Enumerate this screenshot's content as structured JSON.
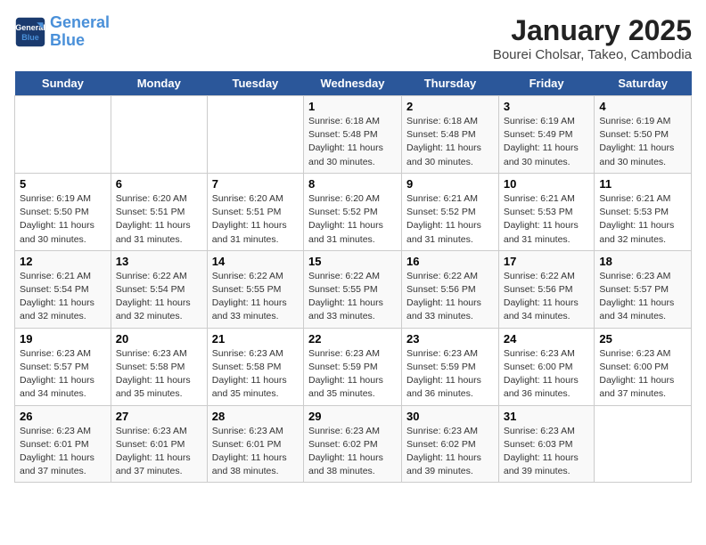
{
  "header": {
    "logo_line1": "General",
    "logo_line2": "Blue",
    "month": "January 2025",
    "location": "Bourei Cholsar, Takeo, Cambodia"
  },
  "weekdays": [
    "Sunday",
    "Monday",
    "Tuesday",
    "Wednesday",
    "Thursday",
    "Friday",
    "Saturday"
  ],
  "weeks": [
    [
      {
        "day": "",
        "info": ""
      },
      {
        "day": "",
        "info": ""
      },
      {
        "day": "",
        "info": ""
      },
      {
        "day": "1",
        "info": "Sunrise: 6:18 AM\nSunset: 5:48 PM\nDaylight: 11 hours\nand 30 minutes."
      },
      {
        "day": "2",
        "info": "Sunrise: 6:18 AM\nSunset: 5:48 PM\nDaylight: 11 hours\nand 30 minutes."
      },
      {
        "day": "3",
        "info": "Sunrise: 6:19 AM\nSunset: 5:49 PM\nDaylight: 11 hours\nand 30 minutes."
      },
      {
        "day": "4",
        "info": "Sunrise: 6:19 AM\nSunset: 5:50 PM\nDaylight: 11 hours\nand 30 minutes."
      }
    ],
    [
      {
        "day": "5",
        "info": "Sunrise: 6:19 AM\nSunset: 5:50 PM\nDaylight: 11 hours\nand 30 minutes."
      },
      {
        "day": "6",
        "info": "Sunrise: 6:20 AM\nSunset: 5:51 PM\nDaylight: 11 hours\nand 31 minutes."
      },
      {
        "day": "7",
        "info": "Sunrise: 6:20 AM\nSunset: 5:51 PM\nDaylight: 11 hours\nand 31 minutes."
      },
      {
        "day": "8",
        "info": "Sunrise: 6:20 AM\nSunset: 5:52 PM\nDaylight: 11 hours\nand 31 minutes."
      },
      {
        "day": "9",
        "info": "Sunrise: 6:21 AM\nSunset: 5:52 PM\nDaylight: 11 hours\nand 31 minutes."
      },
      {
        "day": "10",
        "info": "Sunrise: 6:21 AM\nSunset: 5:53 PM\nDaylight: 11 hours\nand 31 minutes."
      },
      {
        "day": "11",
        "info": "Sunrise: 6:21 AM\nSunset: 5:53 PM\nDaylight: 11 hours\nand 32 minutes."
      }
    ],
    [
      {
        "day": "12",
        "info": "Sunrise: 6:21 AM\nSunset: 5:54 PM\nDaylight: 11 hours\nand 32 minutes."
      },
      {
        "day": "13",
        "info": "Sunrise: 6:22 AM\nSunset: 5:54 PM\nDaylight: 11 hours\nand 32 minutes."
      },
      {
        "day": "14",
        "info": "Sunrise: 6:22 AM\nSunset: 5:55 PM\nDaylight: 11 hours\nand 33 minutes."
      },
      {
        "day": "15",
        "info": "Sunrise: 6:22 AM\nSunset: 5:55 PM\nDaylight: 11 hours\nand 33 minutes."
      },
      {
        "day": "16",
        "info": "Sunrise: 6:22 AM\nSunset: 5:56 PM\nDaylight: 11 hours\nand 33 minutes."
      },
      {
        "day": "17",
        "info": "Sunrise: 6:22 AM\nSunset: 5:56 PM\nDaylight: 11 hours\nand 34 minutes."
      },
      {
        "day": "18",
        "info": "Sunrise: 6:23 AM\nSunset: 5:57 PM\nDaylight: 11 hours\nand 34 minutes."
      }
    ],
    [
      {
        "day": "19",
        "info": "Sunrise: 6:23 AM\nSunset: 5:57 PM\nDaylight: 11 hours\nand 34 minutes."
      },
      {
        "day": "20",
        "info": "Sunrise: 6:23 AM\nSunset: 5:58 PM\nDaylight: 11 hours\nand 35 minutes."
      },
      {
        "day": "21",
        "info": "Sunrise: 6:23 AM\nSunset: 5:58 PM\nDaylight: 11 hours\nand 35 minutes."
      },
      {
        "day": "22",
        "info": "Sunrise: 6:23 AM\nSunset: 5:59 PM\nDaylight: 11 hours\nand 35 minutes."
      },
      {
        "day": "23",
        "info": "Sunrise: 6:23 AM\nSunset: 5:59 PM\nDaylight: 11 hours\nand 36 minutes."
      },
      {
        "day": "24",
        "info": "Sunrise: 6:23 AM\nSunset: 6:00 PM\nDaylight: 11 hours\nand 36 minutes."
      },
      {
        "day": "25",
        "info": "Sunrise: 6:23 AM\nSunset: 6:00 PM\nDaylight: 11 hours\nand 37 minutes."
      }
    ],
    [
      {
        "day": "26",
        "info": "Sunrise: 6:23 AM\nSunset: 6:01 PM\nDaylight: 11 hours\nand 37 minutes."
      },
      {
        "day": "27",
        "info": "Sunrise: 6:23 AM\nSunset: 6:01 PM\nDaylight: 11 hours\nand 37 minutes."
      },
      {
        "day": "28",
        "info": "Sunrise: 6:23 AM\nSunset: 6:01 PM\nDaylight: 11 hours\nand 38 minutes."
      },
      {
        "day": "29",
        "info": "Sunrise: 6:23 AM\nSunset: 6:02 PM\nDaylight: 11 hours\nand 38 minutes."
      },
      {
        "day": "30",
        "info": "Sunrise: 6:23 AM\nSunset: 6:02 PM\nDaylight: 11 hours\nand 39 minutes."
      },
      {
        "day": "31",
        "info": "Sunrise: 6:23 AM\nSunset: 6:03 PM\nDaylight: 11 hours\nand 39 minutes."
      },
      {
        "day": "",
        "info": ""
      }
    ]
  ]
}
